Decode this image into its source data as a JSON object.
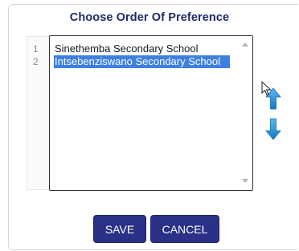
{
  "dialog": {
    "title": "Choose Order Of Preference"
  },
  "preference_list": {
    "row_numbers": [
      "1",
      "2"
    ],
    "items": [
      {
        "label": "Sinethemba Secondary School",
        "selected": false
      },
      {
        "label": "Intsebenziswano Secondary School",
        "selected": true
      }
    ]
  },
  "controls": {
    "move_up_icon": "arrow-up-icon",
    "move_down_icon": "arrow-down-icon",
    "save_label": "SAVE",
    "cancel_label": "CANCEL"
  },
  "colors": {
    "title": "#1e2a6e",
    "selection": "#3d80e2",
    "button": "#2a3186",
    "arrow": "#1a8fd6"
  }
}
